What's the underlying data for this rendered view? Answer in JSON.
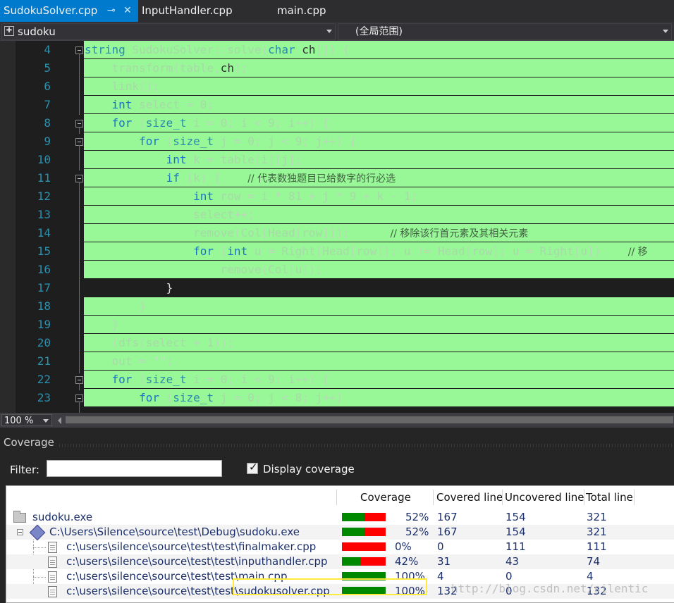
{
  "tabs": [
    {
      "label": "SudokuSolver.cpp",
      "active": true
    },
    {
      "label": "InputHandler.cpp",
      "active": false
    },
    {
      "label": "main.cpp",
      "active": false
    }
  ],
  "nav": {
    "project": "sudoku",
    "scope": "(全局范围)"
  },
  "editor": {
    "line_numbers": [
      "4",
      "5",
      "6",
      "7",
      "8",
      "9",
      "10",
      "11",
      "12",
      "13",
      "14",
      "15",
      "16",
      "17",
      "18",
      "19",
      "20",
      "21",
      "22",
      "23"
    ],
    "comments": {
      "c11": "// 代表数独题目已给数字的行必选",
      "c14": "// 移除该行首元素及其相关元素",
      "c15": "// 移"
    }
  },
  "zoom": {
    "level": "100 %"
  },
  "coverage": {
    "panel_title": "Coverage",
    "filter_label": "Filter:",
    "filter_value": "",
    "display_coverage_label": "Display coverage",
    "display_coverage_checked": true,
    "columns": [
      "Coverage",
      "Covered line",
      "Uncovered line",
      "Total line"
    ],
    "rows": [
      {
        "name": "sudoku.exe",
        "coverage_pct": "52%",
        "coverage": 0.52,
        "covered": "167",
        "uncovered": "154",
        "total": "321",
        "icon": "folder-icon"
      },
      {
        "name": "C:\\Users\\Silence\\source\\test\\Debug\\sudoku.exe",
        "coverage_pct": "52%",
        "coverage": 0.52,
        "covered": "167",
        "uncovered": "154",
        "total": "321",
        "icon": "exe-icon"
      },
      {
        "name": "c:\\users\\silence\\source\\test\\test\\finalmaker.cpp",
        "coverage_pct": "0%",
        "coverage": 0.0,
        "covered": "0",
        "uncovered": "111",
        "total": "111",
        "icon": "file-icon"
      },
      {
        "name": "c:\\users\\silence\\source\\test\\test\\inputhandler.cpp",
        "coverage_pct": "42%",
        "coverage": 0.42,
        "covered": "31",
        "uncovered": "43",
        "total": "74",
        "icon": "file-icon"
      },
      {
        "name": "c:\\users\\silence\\source\\test\\test\\main.cpp",
        "coverage_pct": "100%",
        "coverage": 1.0,
        "covered": "4",
        "uncovered": "0",
        "total": "4",
        "icon": "file-icon"
      },
      {
        "name": "c:\\users\\silence\\source\\test\\test\\sudokusolver.cpp",
        "coverage_pct": "100%",
        "coverage": 1.0,
        "covered": "132",
        "uncovered": "0",
        "total": "132",
        "icon": "file-icon"
      }
    ]
  },
  "watermark": "http://blog.csdn.net/silentic",
  "colors": {
    "covered": "#98f898",
    "bar_covered": "#008800",
    "bar_uncovered": "#ff0000",
    "accent": "#007acc",
    "highlight": "#ffeb3b"
  }
}
